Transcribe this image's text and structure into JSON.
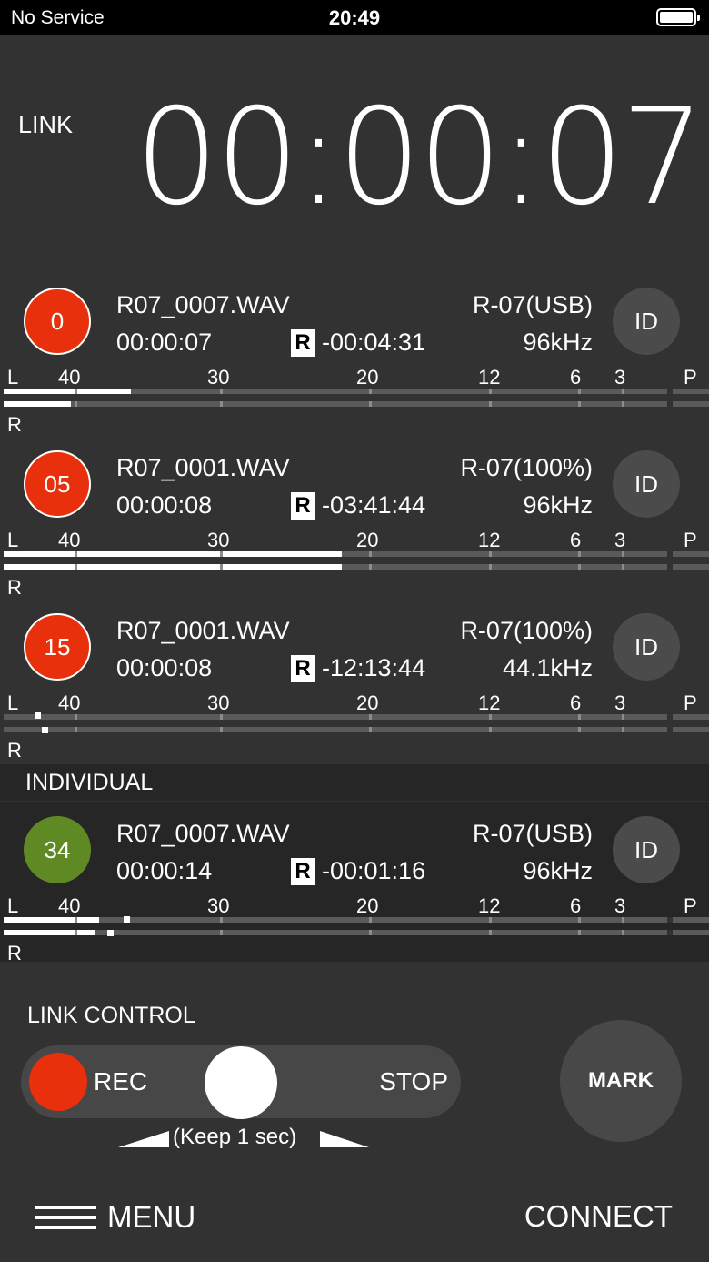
{
  "status": {
    "carrier": "No Service",
    "time": "20:49"
  },
  "header": {
    "link_label": "LINK",
    "elapsed": "00:00:07"
  },
  "scale_labels": {
    "l": "L",
    "r": "R",
    "p": "P",
    "db": [
      "40",
      "30",
      "20",
      "12",
      "6",
      "3"
    ]
  },
  "tracks": [
    {
      "badge": "0",
      "file": "R07_0007.WAV",
      "time": "00:00:07",
      "r_mark": "R",
      "remaining": "-00:04:31",
      "device": "R-07(USB)",
      "rate": "96kHz",
      "id_label": "ID",
      "level_l": 0.18,
      "level_r": 0.095
    },
    {
      "badge": "05",
      "file": "R07_0001.WAV",
      "time": "00:00:08",
      "r_mark": "R",
      "remaining": "-03:41:44",
      "device": "R-07(100%)",
      "rate": "96kHz",
      "id_label": "ID",
      "level_l": 0.48,
      "level_r": 0.48
    },
    {
      "badge": "15",
      "file": "R07_0001.WAV",
      "time": "00:00:08",
      "r_mark": "R",
      "remaining": "-12:13:44",
      "device": "R-07(100%)",
      "rate": "44.1kHz",
      "id_label": "ID",
      "level_l": 0.0,
      "level_r": 0.0
    }
  ],
  "individual": {
    "section_label": "INDIVIDUAL",
    "track": {
      "badge": "34",
      "file": "R07_0007.WAV",
      "time": "00:00:14",
      "r_mark": "R",
      "remaining": "-00:01:16",
      "device": "R-07(USB)",
      "rate": "96kHz",
      "id_label": "ID",
      "level_l": 0.135,
      "level_r": 0.13
    }
  },
  "control": {
    "section_label": "LINK CONTROL",
    "rec_label": "REC",
    "stop_label": "STOP",
    "hint": "(Keep 1 sec)",
    "mark_label": "MARK"
  },
  "footer": {
    "menu_label": "MENU",
    "connect_label": "CONNECT"
  },
  "colors": {
    "record_red": "#e8310c",
    "individual_green": "#5f8a23",
    "background": "#323232"
  },
  "icons": [
    "battery-icon",
    "hamburger-menu-icon",
    "arrow-left-icon",
    "arrow-right-icon"
  ]
}
